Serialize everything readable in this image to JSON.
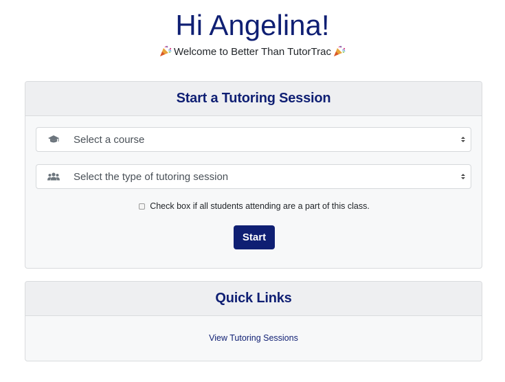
{
  "greeting": "Hi Angelina!",
  "welcome": "Welcome to Better Than TutorTrac",
  "session_card": {
    "title": "Start a Tutoring Session",
    "course_select": {
      "selected": "Select a course",
      "icon": "graduation-cap-icon"
    },
    "type_select": {
      "selected": "Select the type of tutoring session",
      "icon": "users-icon"
    },
    "checkbox_label": "Check box if all students attending are a part of this class.",
    "checkbox_checked": false,
    "start_label": "Start"
  },
  "links_card": {
    "title": "Quick Links",
    "links": [
      {
        "label": "View Tutoring Sessions"
      }
    ]
  },
  "colors": {
    "brand": "#0f1f73",
    "card_bg": "#f7f8f9",
    "header_bg": "#eeeff1"
  }
}
